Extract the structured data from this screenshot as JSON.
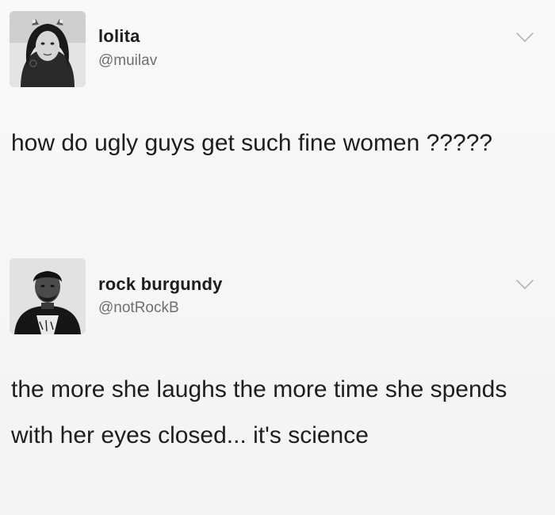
{
  "tweets": [
    {
      "author": {
        "display_name": "lolita",
        "handle": "@muilav",
        "avatar_icon": "user-photo-avatar"
      },
      "text": "how do ugly guys get such fine women ?????",
      "menu_icon": "chevron-down-icon"
    },
    {
      "author": {
        "display_name": "rock burgundy",
        "handle": "@notRockB",
        "avatar_icon": "user-photo-avatar"
      },
      "text": "the more she laughs the more time she spends with her eyes closed...  it's science",
      "menu_icon": "chevron-down-icon"
    }
  ],
  "colors": {
    "background": "#f7f7f7",
    "text": "#1e1e1e",
    "handle": "#6f6f6f",
    "chevron": "#b5b5b5"
  }
}
